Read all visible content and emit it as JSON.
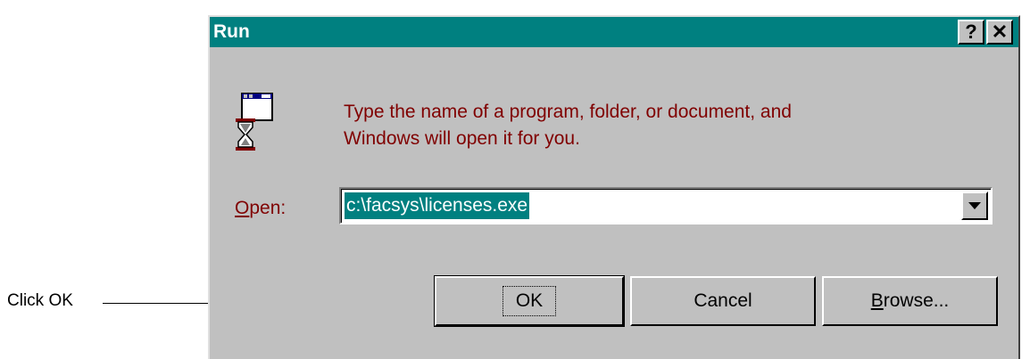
{
  "callout": {
    "text": "Click OK"
  },
  "dialog": {
    "title": "Run",
    "help_glyph": "?",
    "close_glyph": "✕",
    "icon": "run-program-icon",
    "message_line1": "Type the name of a program, folder, or document, and",
    "message_line2": "Windows will open it for you.",
    "open_label_accel": "O",
    "open_label_rest": "pen:",
    "open_value": "c:\\facsys\\licenses.exe",
    "buttons": {
      "ok": "OK",
      "cancel": "Cancel",
      "browse_accel": "B",
      "browse_rest": "rowse..."
    }
  },
  "colors": {
    "titlebar": "#008080",
    "face": "#c0c0c0",
    "message_text": "#800000",
    "selection": "#008080"
  }
}
